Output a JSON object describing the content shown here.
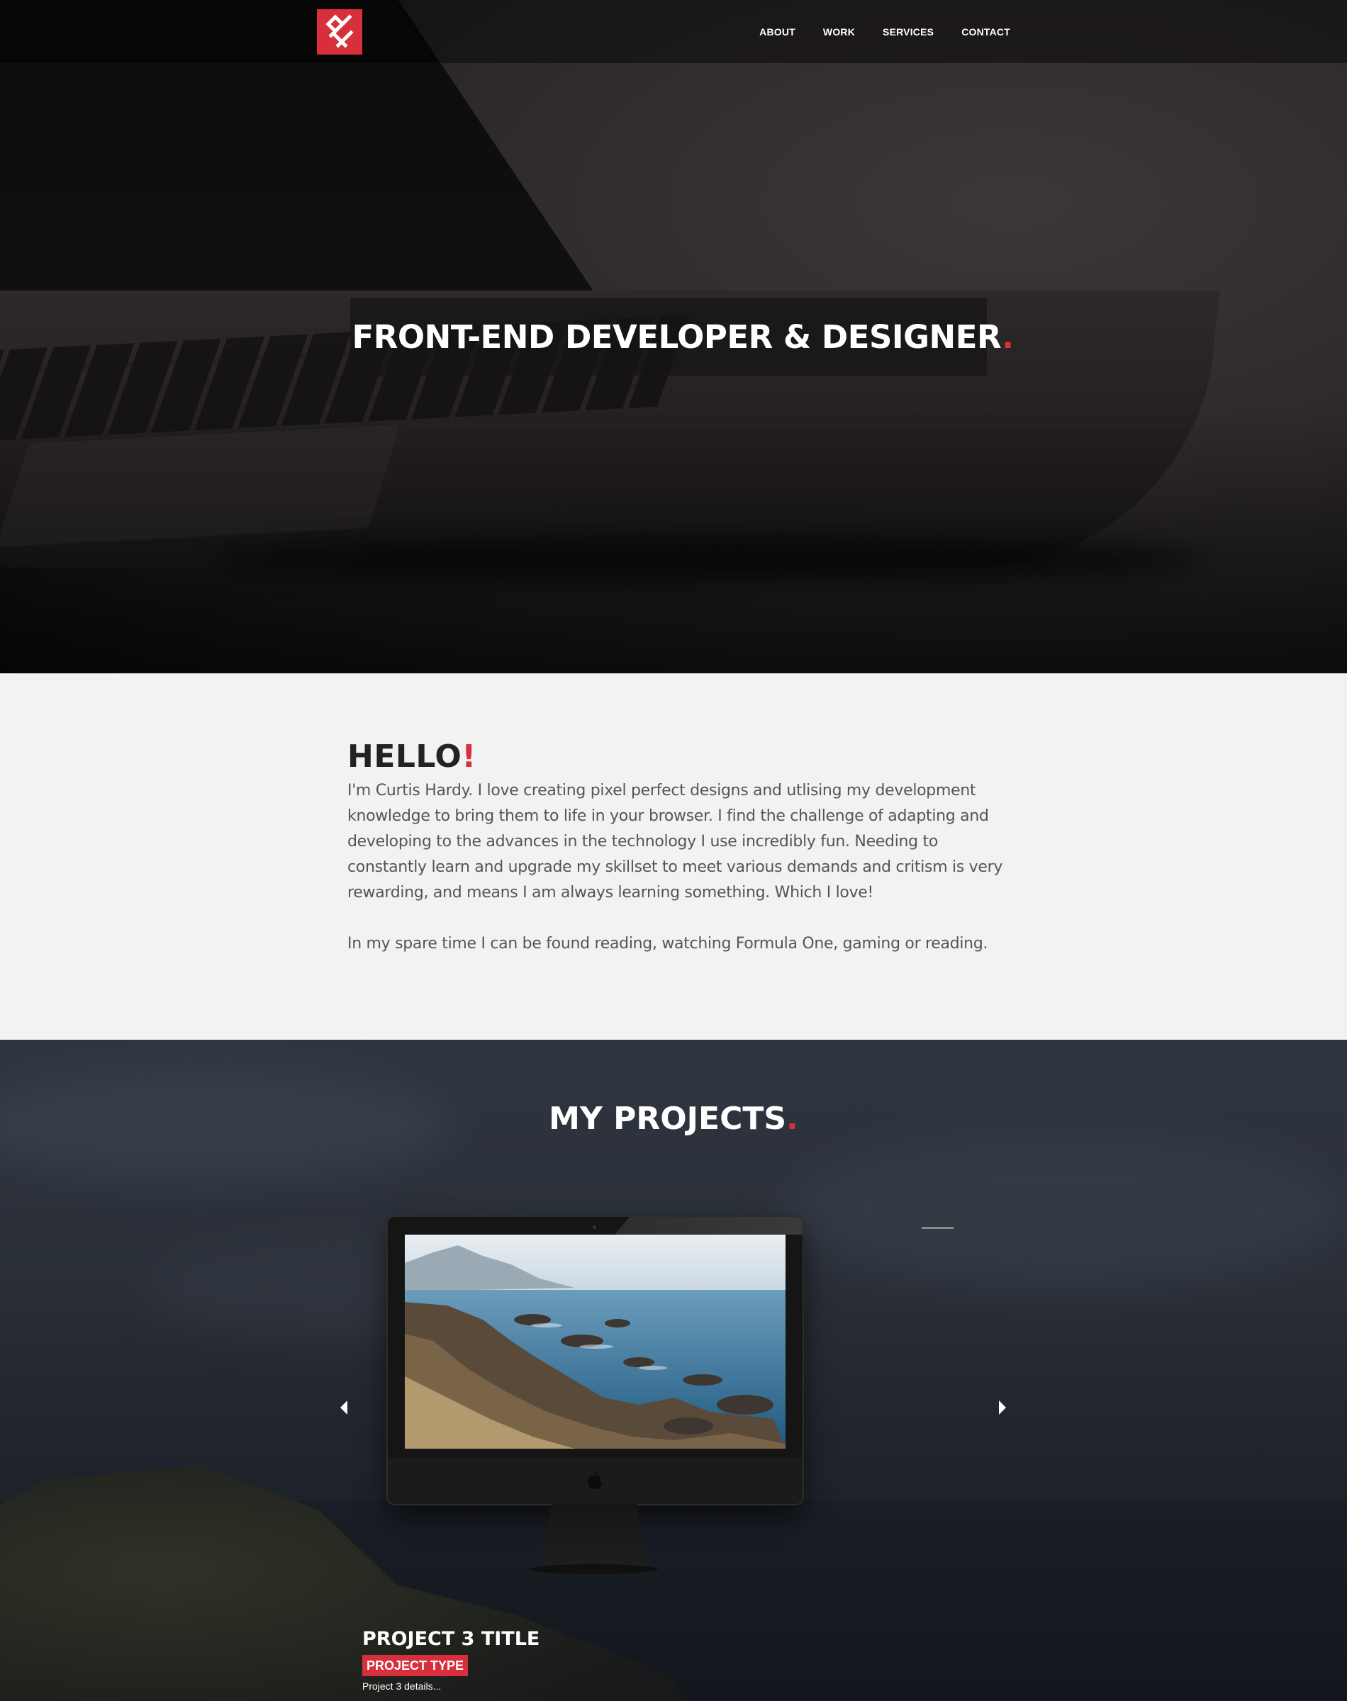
{
  "brand": {
    "logo_name": "HF monogram logo",
    "accent_color": "#d72f3c"
  },
  "nav": {
    "items": [
      {
        "label": "ABOUT"
      },
      {
        "label": "WORK"
      },
      {
        "label": "SERVICES"
      },
      {
        "label": "CONTACT"
      }
    ]
  },
  "hero": {
    "title": "FRONT-END DEVELOPER & DESIGNER",
    "title_accent": "."
  },
  "about": {
    "heading": "HELLO",
    "heading_accent": "!",
    "paragraphs": [
      "I'm Curtis Hardy. I love creating pixel perfect designs and utlising my development knowledge to bring them to life in your browser. I find the challenge of adapting and developing to the advances in the technology I use incredibly fun. Needing to constantly learn and upgrade my skillset to meet various demands and critism is very rewarding, and means I am always learning something. Which I love!",
      "In my spare time I can be found reading, watching Formula One, gaming or reading."
    ]
  },
  "projects": {
    "heading": "MY PROJECTS",
    "heading_accent": ".",
    "current": {
      "title": "PROJECT 3 TITLE",
      "type": "PROJECT TYPE",
      "details": "Project 3 details..."
    }
  }
}
